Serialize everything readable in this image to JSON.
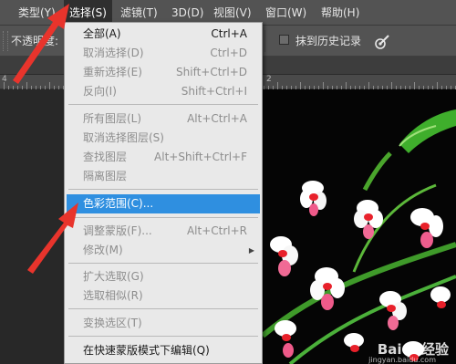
{
  "menubar": {
    "items": [
      {
        "label": "类型(Y)"
      },
      {
        "label": "选择(S)"
      },
      {
        "label": "滤镜(T)"
      },
      {
        "label": "3D(D)"
      },
      {
        "label": "视图(V)"
      },
      {
        "label": "窗口(W)"
      },
      {
        "label": "帮助(H)"
      }
    ],
    "active_index": 1
  },
  "options_bar": {
    "opacity_label": "不透明度:",
    "erase_to_history_label": "抹到历史记录",
    "erase_to_history_checked": false
  },
  "ruler": {
    "numbers": [
      "4",
      "2"
    ]
  },
  "select_menu": {
    "items": [
      {
        "label": "全部(A)",
        "shortcut": "Ctrl+A",
        "disabled": false
      },
      {
        "label": "取消选择(D)",
        "shortcut": "Ctrl+D",
        "disabled": true
      },
      {
        "label": "重新选择(E)",
        "shortcut": "Shift+Ctrl+D",
        "disabled": true
      },
      {
        "label": "反向(I)",
        "shortcut": "Shift+Ctrl+I",
        "disabled": true
      },
      {
        "label": "所有图层(L)",
        "shortcut": "Alt+Ctrl+A",
        "disabled": true
      },
      {
        "label": "取消选择图层(S)",
        "shortcut": "",
        "disabled": true
      },
      {
        "label": "查找图层",
        "shortcut": "Alt+Shift+Ctrl+F",
        "disabled": true
      },
      {
        "label": "隔离图层",
        "shortcut": "",
        "disabled": true
      },
      {
        "label": "色彩范围(C)...",
        "shortcut": "",
        "disabled": false,
        "highlighted": true
      },
      {
        "label": "调整蒙版(F)...",
        "shortcut": "Alt+Ctrl+R",
        "disabled": true
      },
      {
        "label": "修改(M)",
        "shortcut": "",
        "disabled": true,
        "submenu": true
      },
      {
        "label": "扩大选取(G)",
        "shortcut": "",
        "disabled": true
      },
      {
        "label": "选取相似(R)",
        "shortcut": "",
        "disabled": true
      },
      {
        "label": "变换选区(T)",
        "shortcut": "",
        "disabled": true
      },
      {
        "label": "在快速蒙版模式下编辑(Q)",
        "shortcut": "",
        "disabled": false
      }
    ]
  },
  "watermark": {
    "text": "Baidu经验",
    "sub": "jingyan.baidu.com"
  },
  "colors": {
    "highlight": "#2f8fe0",
    "annotation_arrow": "#e8342c",
    "menu_bg": "#e9e9e9"
  }
}
